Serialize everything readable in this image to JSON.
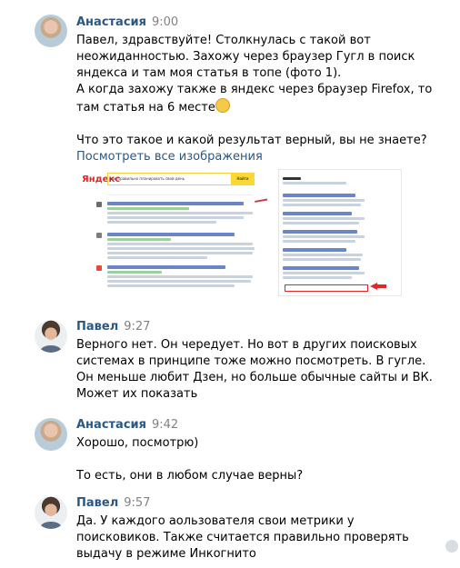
{
  "messages": [
    {
      "author": "Анастасия",
      "time": "9:00",
      "paragraphs": [
        "Павел, здравствуйте! Столкнулась с такой вот неожиданностью. Захожу через браузер Гугл в поиск яндекса и там моя статья в топе (фото 1).",
        "А когда захожу также в яндекс через браузер Firefox, то там статья на 6 месте",
        "Что это такое и какой результат верный, вы не знаете?"
      ],
      "emoji_icon": "worried-face-icon",
      "link_label": "Посмотреть все изображения",
      "screenshot1": {
        "logo": "Яндекс",
        "query": "как правильно планировать свой день",
        "button": "Найти"
      }
    },
    {
      "author": "Павел",
      "time": "9:27",
      "text": "Верного нет. Он чередует. Но вот в других поисковых системах в принципе тоже можно посмотреть. В гугле. Он меньше любит Дзен, но больше обычные сайты и ВК. Может их показать"
    },
    {
      "author": "Анастасия",
      "time": "9:42",
      "paragraphs": [
        "Хорошо, посмотрю)",
        "То есть, они в любом случае верны?"
      ]
    },
    {
      "author": "Павел",
      "time": "9:57",
      "text": "Да. У каждого аользователя свои метрики у поисковиков. Также считается правильно проверять выдачу в режиме Инкогнито"
    }
  ],
  "colors": {
    "name": "#2a5885",
    "time": "#828282",
    "link": "#2a5885"
  }
}
